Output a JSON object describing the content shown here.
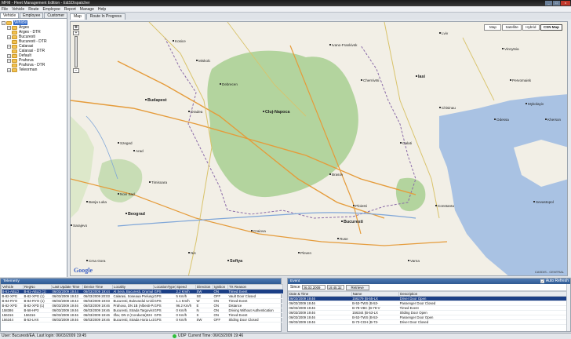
{
  "window": {
    "title": "MFM - Fleet Management Edition - E&SDispatcher",
    "buttons": [
      "_",
      "□",
      "x"
    ]
  },
  "menu": [
    "File",
    "Vehicle",
    "Route",
    "Employee",
    "Report",
    "Manage",
    "Help"
  ],
  "left_tabs": [
    "Vehicle",
    "Employee",
    "Customer"
  ],
  "tree": [
    {
      "label": "Vehicle",
      "expander": "−",
      "selected": true,
      "indent": 0
    },
    {
      "label": "Arges",
      "expander": "+",
      "indent": 1
    },
    {
      "label": "Arges - DTR",
      "expander": "",
      "indent": 1
    },
    {
      "label": "Bucuresti",
      "expander": "+",
      "indent": 1
    },
    {
      "label": "Bucuresti - DTR",
      "expander": "",
      "indent": 1
    },
    {
      "label": "Calarasi",
      "expander": "+",
      "indent": 1
    },
    {
      "label": "Calarasi - DTR",
      "expander": "",
      "indent": 1
    },
    {
      "label": "Default",
      "expander": "+",
      "indent": 1
    },
    {
      "label": "Prahova",
      "expander": "+",
      "indent": 1
    },
    {
      "label": "Prahova - DTR",
      "expander": "",
      "indent": 1
    },
    {
      "label": "Teleorman",
      "expander": "+",
      "indent": 1
    }
  ],
  "map_tabs": [
    "Map",
    "Route In Progress"
  ],
  "map_types": [
    "Map",
    "Satellite",
    "Hybrid",
    "CSN Map"
  ],
  "map_type_active": "CSN Map",
  "map_labels": [
    {
      "text": "Lviv",
      "cls": ""
    },
    {
      "text": "Chernivtsi",
      "cls": ""
    },
    {
      "text": "Ivano-Frankivsk",
      "cls": ""
    },
    {
      "text": "Kosice",
      "cls": ""
    },
    {
      "text": "Miskolc",
      "cls": ""
    },
    {
      "text": "Debrecen",
      "cls": ""
    },
    {
      "text": "Budapest",
      "cls": "big"
    },
    {
      "text": "Szeged",
      "cls": ""
    },
    {
      "text": "Oradea",
      "cls": ""
    },
    {
      "text": "Cluj-Napoca",
      "cls": "big"
    },
    {
      "text": "Timisoara",
      "cls": ""
    },
    {
      "text": "Arad",
      "cls": ""
    },
    {
      "text": "Brasov",
      "cls": ""
    },
    {
      "text": "Iasi",
      "cls": "big"
    },
    {
      "text": "Chisinau",
      "cls": ""
    },
    {
      "text": "Galati",
      "cls": ""
    },
    {
      "text": "Ploiesti",
      "cls": ""
    },
    {
      "text": "Bucuresti",
      "cls": "big"
    },
    {
      "text": "Constanta",
      "cls": ""
    },
    {
      "text": "Craiova",
      "cls": ""
    },
    {
      "text": "Beograd",
      "cls": "big"
    },
    {
      "text": "Novi Sad",
      "cls": ""
    },
    {
      "text": "Sofiya",
      "cls": "big"
    },
    {
      "text": "Varna",
      "cls": ""
    },
    {
      "text": "Odessa",
      "cls": ""
    },
    {
      "text": "Mykolayiv",
      "cls": ""
    },
    {
      "text": "Kherson",
      "cls": ""
    },
    {
      "text": "Pervomaisk",
      "cls": ""
    },
    {
      "text": "Vinnytsia",
      "cls": ""
    },
    {
      "text": "Sarajevo",
      "cls": ""
    },
    {
      "text": "Banja Luka",
      "cls": ""
    },
    {
      "text": "Nis",
      "cls": ""
    },
    {
      "text": "Pleven",
      "cls": ""
    },
    {
      "text": "Ruse",
      "cls": ""
    },
    {
      "text": "Crna Gora",
      "cls": ""
    },
    {
      "text": "Sevastopol",
      "cls": ""
    }
  ],
  "map_footer": {
    "logo": "Google",
    "copyright": "CASDIS - CENTRAL"
  },
  "telemetry": {
    "title": "Telemetry",
    "columns": [
      "Vehicle",
      "RegNo",
      "Last Update Time",
      "Device Time",
      "Locality",
      "LocationType",
      "Speed",
      "Direction",
      "Ignition",
      "TX Reason"
    ],
    "rows": [
      [
        "B-61-ABLD",
        "B-61-ABLD (1)",
        "06/03/2009 19:44",
        "06/03/2009 19:44",
        "Al Sera, Bucuresti, Drumul",
        "GPS",
        "2.2 Km/h",
        "SW",
        "ON",
        "Timed Event"
      ],
      [
        "B-82-XPG",
        "B-82-XPG (1)",
        "06/03/2009 19:43",
        "06/03/2009 20:03",
        "Calarasi, Soseaua Prelungir",
        "GPS",
        "5 Km/h",
        "SE",
        "OFF",
        "Vault Door Closed"
      ],
      [
        "B-84-RYO",
        "B-84-RYO (1)",
        "06/03/2009 19:43",
        "06/03/2009 19:03",
        "Bucuresti, Bulevardul Unirii",
        "GPS",
        "1.1 Km/h",
        "W",
        "ON",
        "Timed Event"
      ],
      [
        "B-82-XPD",
        "B-82-XPD (1)",
        "06/03/2009 19:46",
        "06/03/2009 19:46",
        "Prahova, DN 1B (Albesti-Pal",
        "GPS",
        "96.2 Km/h",
        "E",
        "ON",
        "Distance"
      ],
      [
        "158386",
        "B-58-HP3",
        "06/03/2009 19:46",
        "06/03/2009 19:46",
        "Bucuresti, Strada Targoviste 5",
        "GPS",
        "0 Km/h",
        "N",
        "ON",
        "Driving Without Authentication"
      ],
      [
        "156316",
        "156316",
        "06/03/2009 19:46",
        "06/03/2009 19:46",
        "Ilfov, DN 2 (Conducta)024",
        "GPS",
        "0 Km/h",
        "S",
        "ON",
        "Timed Event"
      ],
      [
        "156344",
        "B-53-LHX",
        "06/03/2009 19:46",
        "06/03/2009 19:46",
        "Bucuresti, Strada Horia Lx1, 53",
        "GPS",
        "0 Km/h",
        "SW",
        "OFF",
        "Sliding Door Closed"
      ]
    ],
    "selected_row": 0
  },
  "events": {
    "title": "Event",
    "since_label": "Since",
    "since_date": "06.03.2009",
    "since_time": "19:45:32",
    "retrieve_label": "Retrieve",
    "auto_refresh_label": "Auto Refresh",
    "auto_refresh_checked": "✓",
    "columns": [
      "Date & Time",
      "Name",
      "Description"
    ],
    "rows": [
      [
        "06/03/2009 19:46",
        "156279 (B-55-LX",
        "Driver Door Open"
      ],
      [
        "06/03/2009 19:46",
        "B-53-TWS (B-53-",
        "Passenger Door Closed"
      ],
      [
        "06/03/2009 19:46",
        "B-78-VBC (B-78-V",
        "Timed Event"
      ],
      [
        "06/03/2009 19:46",
        "156344 (B-53-LX",
        "Sliding Door Open"
      ],
      [
        "06/03/2009 19:46",
        "B-53-TWS (B-53-",
        "Passenger Door Open"
      ],
      [
        "06/03/2009 19:46",
        "B-73-CGH (B-73-",
        "Driver Door Closed"
      ]
    ],
    "selected_row": 0
  },
  "status": {
    "user": "User: Bucuresti/EA, Last login: 06/03/2009 19:45",
    "udp": "UDP",
    "time": "Current Time: 06/03/2009 19:46"
  },
  "colors": {
    "map_land": "#f2efe6",
    "map_sea": "#a9c2e3",
    "forest": "#9fc98a",
    "selection": "#1b3f86"
  }
}
